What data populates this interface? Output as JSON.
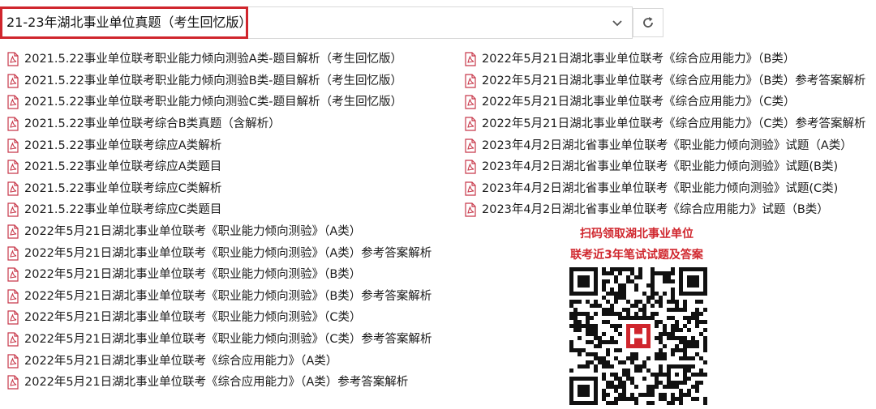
{
  "address_bar": {
    "path": "21-23年湖北事业单位真题（考生回忆版）",
    "dropdown_icon": "chevron-down-icon",
    "refresh_icon": "refresh-icon"
  },
  "files_left": [
    "2021.5.22事业单位联考职业能力倾向测验A类-题目解析（考生回忆版）",
    "2021.5.22事业单位联考职业能力倾向测验B类-题目解析（考生回忆版）",
    "2021.5.22事业单位联考职业能力倾向测验C类-题目解析（考生回忆版）",
    "2021.5.22事业单位联考综合B类真题（含解析）",
    "2021.5.22事业单位联考综应A类解析",
    "2021.5.22事业单位联考综应A类题目",
    "2021.5.22事业单位联考综应C类解析",
    "2021.5.22事业单位联考综应C类题目",
    "2022年5月21日湖北事业单位联考《职业能力倾向测验》（A类）",
    "2022年5月21日湖北事业单位联考《职业能力倾向测验》（A类）参考答案解析",
    "2022年5月21日湖北事业单位联考《职业能力倾向测验》（B类）",
    "2022年5月21日湖北事业单位联考《职业能力倾向测验》（B类）参考答案解析",
    "2022年5月21日湖北事业单位联考《职业能力倾向测验》（C类）",
    "2022年5月21日湖北事业单位联考《职业能力倾向测验》（C类）参考答案解析",
    "2022年5月21日湖北事业单位联考《综合应用能力》（A类）",
    "2022年5月21日湖北事业单位联考《综合应用能力》（A类）参考答案解析"
  ],
  "files_right": [
    "2022年5月21日湖北事业单位联考《综合应用能力》（B类）",
    "2022年5月21日湖北事业单位联考《综合应用能力》（B类）参考答案解析",
    "2022年5月21日湖北事业单位联考《综合应用能力》（C类）",
    "2022年5月21日湖北事业单位联考《综合应用能力》（C类）参考答案解析",
    "2023年4月2日湖北省事业单位联考《职业能力倾向测验》试题（A类）",
    "2023年4月2日湖北省事业单位联考《职业能力倾向测验》试题(B类)",
    "2023年4月2日湖北省事业单位联考《职业能力倾向测验》试题(C类)",
    "2023年4月2日湖北省事业单位联考《综合应用能力》试题（B类）"
  ],
  "file_icon": "pdf-file-icon",
  "promo": {
    "line1": "扫码领取湖北事业单位",
    "line2": "联考近3年笔试试题及答案",
    "qr_icon": "qr-code-icon",
    "color": "#d0262d"
  },
  "colors": {
    "highlight": "#d0262d",
    "pdf_icon": "#c8384a"
  }
}
